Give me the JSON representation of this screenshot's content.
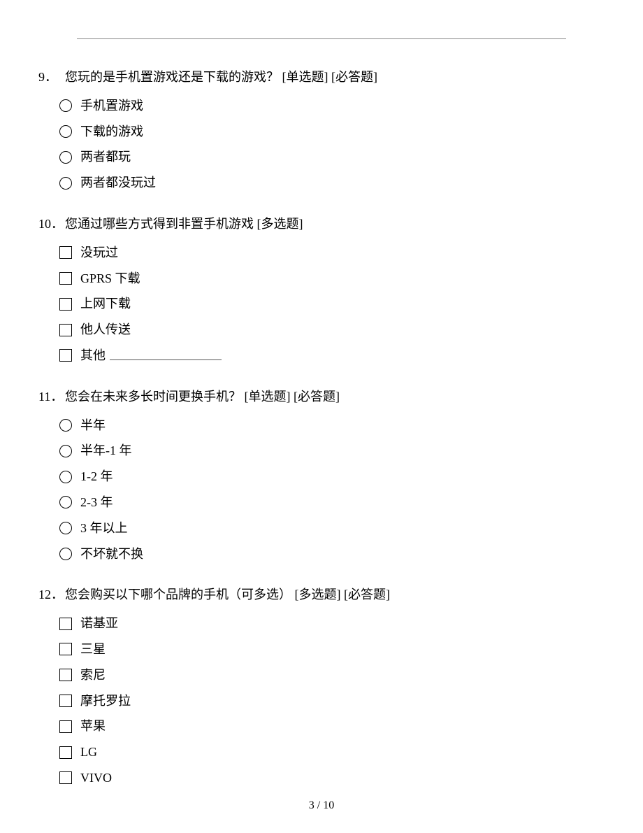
{
  "pager": "3 / 10",
  "questions": [
    {
      "number": "9．",
      "text": "您玩的是手机置游戏还是下载的游戏？ [单选题] [必答题]",
      "type": "single",
      "options": [
        {
          "label": "手机置游戏",
          "fillin": false
        },
        {
          "label": "下载的游戏",
          "fillin": false
        },
        {
          "label": "两者都玩",
          "fillin": false
        },
        {
          "label": "两者都没玩过",
          "fillin": false
        }
      ]
    },
    {
      "number": "10． ",
      "text": "您通过哪些方式得到非置手机游戏 [多选题]",
      "type": "multi",
      "options": [
        {
          "label": "没玩过",
          "fillin": false
        },
        {
          "label": "GPRS 下载",
          "fillin": false
        },
        {
          "label": "上网下载",
          "fillin": false
        },
        {
          "label": "他人传送",
          "fillin": false
        },
        {
          "label": "其他",
          "fillin": true
        }
      ]
    },
    {
      "number": "11． ",
      "text": "您会在未来多长时间更换手机？ [单选题] [必答题]",
      "type": "single",
      "options": [
        {
          "label": "半年",
          "fillin": false
        },
        {
          "label": "半年-1 年",
          "fillin": false
        },
        {
          "label": "1-2 年",
          "fillin": false
        },
        {
          "label": "2-3 年",
          "fillin": false
        },
        {
          "label": "3 年以上",
          "fillin": false
        },
        {
          "label": "不坏就不换",
          "fillin": false
        }
      ]
    },
    {
      "number": "12． ",
      "text": "您会购买以下哪个品牌的手机（可多选） [多选题] [必答题]",
      "type": "multi",
      "options": [
        {
          "label": "诺基亚",
          "fillin": false
        },
        {
          "label": "三星",
          "fillin": false
        },
        {
          "label": "索尼",
          "fillin": false
        },
        {
          "label": "摩托罗拉",
          "fillin": false
        },
        {
          "label": "苹果",
          "fillin": false
        },
        {
          "label": "LG",
          "fillin": false
        },
        {
          "label": "VIVO",
          "fillin": false
        }
      ]
    }
  ]
}
